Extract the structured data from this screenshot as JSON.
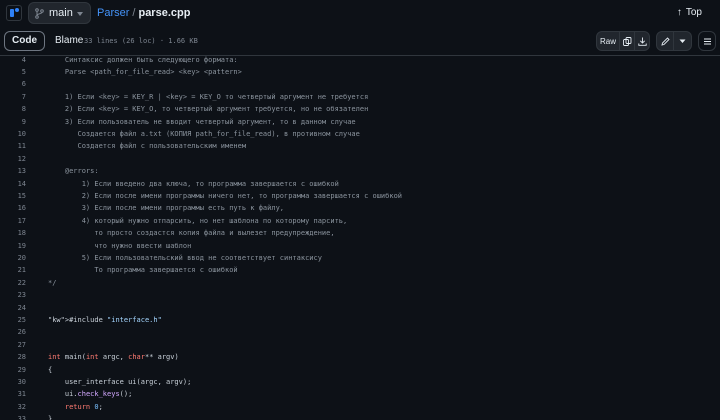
{
  "header": {
    "branch": "main",
    "repo": "Parser",
    "separator": "/",
    "file": "parse.cpp",
    "top_label": "Top",
    "top_arrow": "↑"
  },
  "toolbar": {
    "code_tab": "Code",
    "blame_tab": "Blame",
    "meta": "33 lines (26 loc) · 1.66 KB",
    "raw_label": "Raw"
  },
  "code": {
    "lines": [
      {
        "n": "4",
        "t": "    Синтаксис должен быть следующего формата:"
      },
      {
        "n": "5",
        "t": "    Parse <path_for_file_read> <key> <pattern>"
      },
      {
        "n": "6",
        "t": ""
      },
      {
        "n": "7",
        "t": "    1) Если <key> = KEY_R | <key> = KEY_O то четвертый аргумент не требуется"
      },
      {
        "n": "8",
        "t": "    2) Если <key> = KEY_O, то четвертый аргумент требуется, но не обязателен"
      },
      {
        "n": "9",
        "t": "    3) Если пользователь не вводит четвертый аргумент, то в данном случае"
      },
      {
        "n": "10",
        "t": "       Создается файл a.txt (КОПИЯ path_for_file_read), в противном случае"
      },
      {
        "n": "11",
        "t": "       Создается файл с пользовательским именем"
      },
      {
        "n": "12",
        "t": ""
      },
      {
        "n": "13",
        "t": "    @errors:"
      },
      {
        "n": "14",
        "t": "        1) Если введено два ключа, то программа завершается с ошибкой"
      },
      {
        "n": "15",
        "t": "        2) Если после имени программы ничего нет, то программа завершается с ошибкой"
      },
      {
        "n": "16",
        "t": "        3) Если после имени программы есть путь к файлу,"
      },
      {
        "n": "17",
        "t": "        4) который нужно отпарсить, но нет шаблона по которому парсить,"
      },
      {
        "n": "18",
        "t": "           то просто создастся копия файла и вылезет предупреждение,"
      },
      {
        "n": "19",
        "t": "           что нужно ввести шаблон"
      },
      {
        "n": "20",
        "t": "        5) Если пользовательский ввод не соответствует синтаксису"
      },
      {
        "n": "21",
        "t": "           То программа завершается с ошибкой"
      },
      {
        "n": "22",
        "t": "*/"
      },
      {
        "n": "23",
        "t": ""
      },
      {
        "n": "24",
        "t": ""
      },
      {
        "n": "25",
        "t": "#include \"interface.h\""
      },
      {
        "n": "26",
        "t": ""
      },
      {
        "n": "27",
        "t": ""
      },
      {
        "n": "28",
        "t": "int main(int argc, char** argv)"
      },
      {
        "n": "29",
        "t": "{"
      },
      {
        "n": "30",
        "t": "    user_interface ui(argc, argv);"
      },
      {
        "n": "31",
        "t": "    ui.check_keys();"
      },
      {
        "n": "32",
        "t": "    return 0;"
      },
      {
        "n": "33",
        "t": "}"
      }
    ]
  },
  "colors": {
    "background": "#0d1117",
    "accent": "#4493f8",
    "line_number": "#7d8590",
    "keyword": "#ff7b72",
    "string": "#a5d6ff"
  },
  "icons": [
    "sidebar-toggle-icon",
    "git-branch-icon",
    "arrow-up-icon",
    "copy-icon",
    "download-icon",
    "pencil-icon",
    "kebab-icon"
  ]
}
